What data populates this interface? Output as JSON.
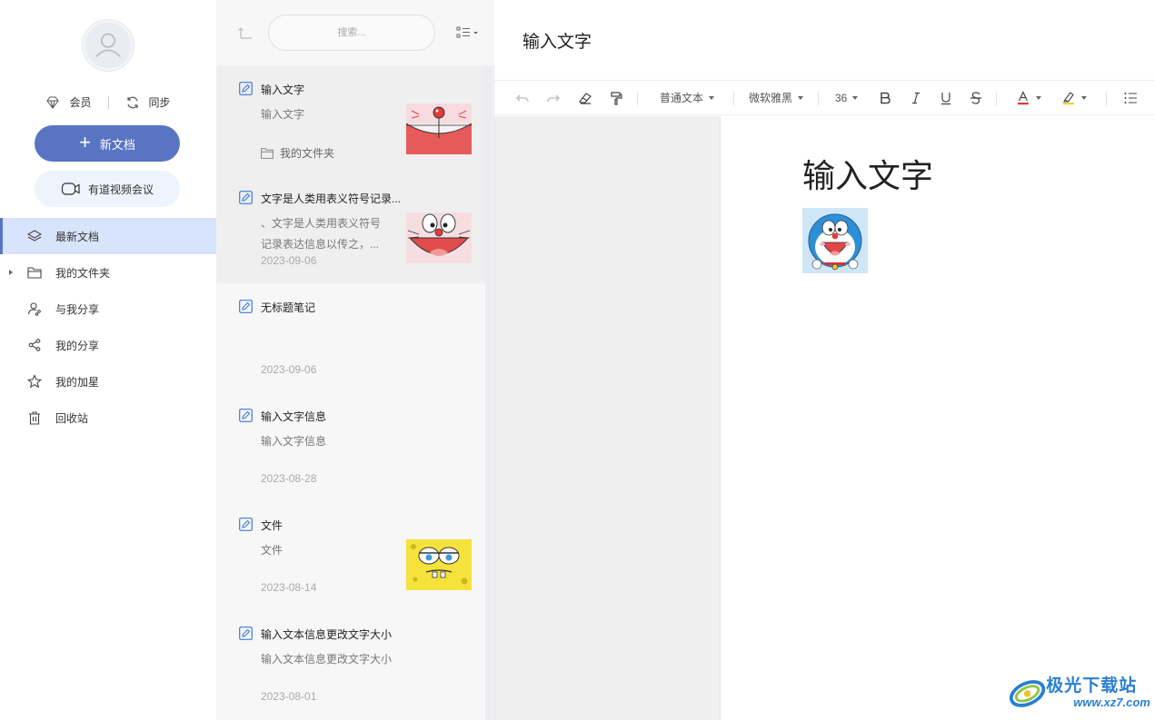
{
  "sidebar": {
    "member_label": "会员",
    "sync_label": "同步",
    "new_doc_label": "新文档",
    "video_meeting_label": "有道视频会议",
    "nav": [
      {
        "label": "最新文档",
        "icon": "layers-icon",
        "active": true
      },
      {
        "label": "我的文件夹",
        "icon": "folder-icon",
        "active": false
      },
      {
        "label": "与我分享",
        "icon": "shared-with-me-icon",
        "active": false
      },
      {
        "label": "我的分享",
        "icon": "share-icon",
        "active": false
      },
      {
        "label": "我的加星",
        "icon": "star-icon",
        "active": false
      },
      {
        "label": "回收站",
        "icon": "trash-icon",
        "active": false
      }
    ]
  },
  "notelist": {
    "search_placeholder": "搜索...",
    "notes": [
      {
        "title": "输入文字",
        "snippet": "输入文字",
        "folder": "我的文件夹",
        "date": "",
        "thumb": "doraemon-mouth"
      },
      {
        "title": "文字是人类用表义符号记录...",
        "snippet": "、文字是人类用表义符号记录表达信息以传之，...",
        "folder": "",
        "date": "2023-09-06",
        "thumb": "doraemon-face"
      },
      {
        "title": "无标题笔记",
        "snippet": "",
        "folder": "",
        "date": "2023-09-06",
        "thumb": ""
      },
      {
        "title": "输入文字信息",
        "snippet": "输入文字信息",
        "folder": "",
        "date": "2023-08-28",
        "thumb": ""
      },
      {
        "title": "文件",
        "snippet": "文件",
        "folder": "",
        "date": "2023-08-14",
        "thumb": "spongebob"
      },
      {
        "title": "输入文本信息更改文字大小",
        "snippet": "输入文本信息更改文字大小",
        "folder": "",
        "date": "2023-08-01",
        "thumb": ""
      }
    ]
  },
  "editor": {
    "doc_title": "输入文字",
    "toolbar": {
      "paragraph_style": "普通文本",
      "font_family": "微软雅黑",
      "font_size": "36"
    },
    "page_heading": "输入文字"
  },
  "watermark": {
    "cn": "极光下载站",
    "url": "www.xz7.com"
  },
  "colors": {
    "accent": "#5874c3",
    "active_nav_bg": "#d8e4fb",
    "video_btn_bg": "#eef4fb"
  }
}
